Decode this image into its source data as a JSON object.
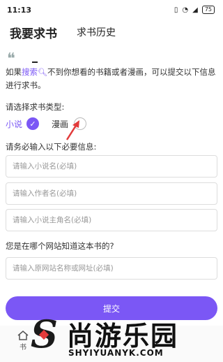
{
  "status_bar": {
    "time": "11:13",
    "battery": "75"
  },
  "tabs": [
    {
      "label": "我要求书",
      "active": true
    },
    {
      "label": "求书历史",
      "active": false
    }
  ],
  "intro": {
    "prefix": "如果",
    "link": "搜索",
    "suffix": "不到你想看的书籍或者漫画，可以提交以下信息进行求书。"
  },
  "book_type": {
    "label": "请选择求书类型:",
    "options": [
      {
        "label": "小说",
        "selected": true
      },
      {
        "label": "漫画",
        "selected": false
      }
    ]
  },
  "required_label": "请务必输入以下必要信息:",
  "fields": {
    "novel_name": {
      "placeholder": "请输入小说名(必填)"
    },
    "author_name": {
      "placeholder": "请输入作者名(必填)"
    },
    "protagonist": {
      "placeholder": "请输入小说主角名(必填)"
    },
    "site": {
      "placeholder": "请输入原网站名称或网址(必填)"
    }
  },
  "site_question": "您是在哪个网站知道这本书的?",
  "submit_label": "提交",
  "bottom_nav": {
    "home_label": "书"
  },
  "watermark": {
    "chinese": "尚游乐园",
    "english": "SHYIYUANYK.COM"
  },
  "colors": {
    "accent": "#7b57f5"
  }
}
